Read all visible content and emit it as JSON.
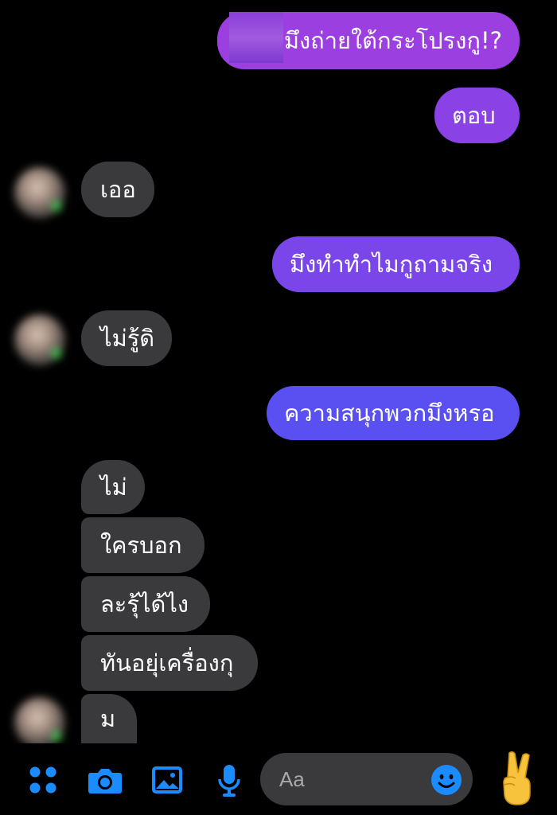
{
  "messages": [
    {
      "id": "m1",
      "dir": "out",
      "text": "มึงถ่ายใต้กระโปรงกู!?"
    },
    {
      "id": "m2",
      "dir": "out",
      "text": "ตอบ"
    },
    {
      "id": "m3",
      "dir": "in",
      "text": "เออ"
    },
    {
      "id": "m4",
      "dir": "out",
      "text": "มึงทำทำไมกูถามจริง"
    },
    {
      "id": "m5",
      "dir": "in",
      "text": "ไม่รู้ดิ"
    },
    {
      "id": "m6",
      "dir": "out",
      "text": "ความสนุกพวกมึงหรอ"
    },
    {
      "id": "m7",
      "dir": "in",
      "text": "ไม่"
    },
    {
      "id": "m8",
      "dir": "in",
      "text": "ใครบอก"
    },
    {
      "id": "m9",
      "dir": "in",
      "text": "ละรุ้ได้ไง"
    },
    {
      "id": "m10",
      "dir": "in",
      "text": "ทันอยุ่เครื่องกุ"
    },
    {
      "id": "m11",
      "dir": "in",
      "text": "ม"
    }
  ],
  "composer": {
    "placeholder": "Aa",
    "icons": [
      "apps-icon",
      "camera-icon",
      "photo-icon",
      "microphone-icon",
      "emoji-icon",
      "peace-hand-icon"
    ]
  },
  "colors": {
    "background": "#000000",
    "incoming_bubble": "#3a3a3c",
    "outgoing_top": "#9b3fe0",
    "outgoing_bottom": "#5a4ff0",
    "icon_blue": "#1a8cff"
  }
}
